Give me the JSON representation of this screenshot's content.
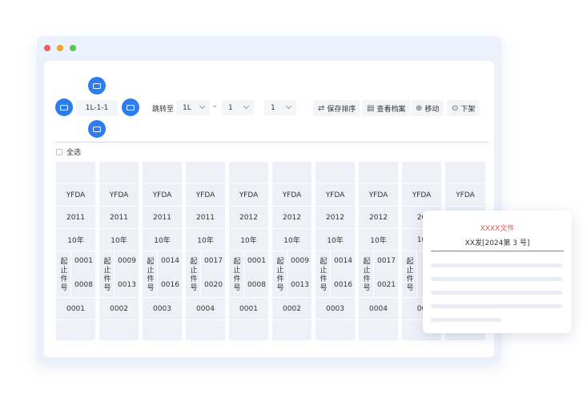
{
  "nav": {
    "position": "1L-1-1"
  },
  "toolbar": {
    "jump_label": "跳转至",
    "select_1": "1L",
    "dash": "–",
    "select_2": "1",
    "select_3": "1",
    "save_order": "保存排序",
    "view_archive": "查看档案",
    "move": "移动",
    "remove": "下架"
  },
  "select_all_label": "全选",
  "range_key": [
    "起",
    "止",
    "件",
    "号"
  ],
  "columns": [
    {
      "label": "YFDA",
      "year": "2011",
      "term": "10年",
      "start": "0001",
      "end": "0008",
      "num": "0001"
    },
    {
      "label": "YFDA",
      "year": "2011",
      "term": "10年",
      "start": "0009",
      "end": "0013",
      "num": "0002"
    },
    {
      "label": "YFDA",
      "year": "2011",
      "term": "10年",
      "start": "0014",
      "end": "0016",
      "num": "0003"
    },
    {
      "label": "YFDA",
      "year": "2011",
      "term": "10年",
      "start": "0017",
      "end": "0020",
      "num": "0004"
    },
    {
      "label": "YFDA",
      "year": "2012",
      "term": "10年",
      "start": "0001",
      "end": "0008",
      "num": "0001"
    },
    {
      "label": "YFDA",
      "year": "2012",
      "term": "10年",
      "start": "0009",
      "end": "0013",
      "num": "0002"
    },
    {
      "label": "YFDA",
      "year": "2012",
      "term": "10年",
      "start": "0014",
      "end": "0016",
      "num": "0003"
    },
    {
      "label": "YFDA",
      "year": "2012",
      "term": "10年",
      "start": "0017",
      "end": "0021",
      "num": "0004"
    },
    {
      "label": "YFDA",
      "year": "20",
      "term": "10",
      "start": "",
      "end": "",
      "num": "00"
    },
    {
      "label": "YFDA",
      "year": "",
      "term": "",
      "start": "",
      "end": "",
      "num": ""
    }
  ],
  "doc_preview": {
    "title": "XXXX文件",
    "subtitle": "XX发[2024第 3 号]"
  },
  "colors": {
    "accent": "#2b7df0",
    "doc_red": "#e55353",
    "column_bg": "#eef0f8",
    "window_bg": "#eaf1fb"
  }
}
